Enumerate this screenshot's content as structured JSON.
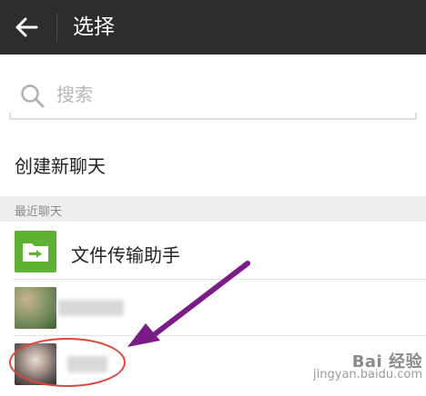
{
  "header": {
    "title": "选择",
    "back_icon": "arrow-left-icon"
  },
  "search": {
    "placeholder": "搜索",
    "icon": "search-icon",
    "value": ""
  },
  "new_chat": {
    "label": "创建新聊天"
  },
  "recent": {
    "header": "最近聊天",
    "items": [
      {
        "name": "文件传输助手",
        "avatar": "file-transfer-folder-icon"
      },
      {
        "name": "",
        "avatar": "blurred-photo-avatar"
      },
      {
        "name": "",
        "avatar": "blurred-photo-avatar"
      }
    ]
  },
  "watermark": {
    "logo": "Bai 经验",
    "url": "jingyan.baidu.com"
  },
  "colors": {
    "topbar": "#2b2d2f",
    "accent_green": "#5fb133",
    "annotation_arrow": "#7b1b87",
    "annotation_circle": "#e0453a",
    "section_header_bg": "#eeeeee"
  }
}
